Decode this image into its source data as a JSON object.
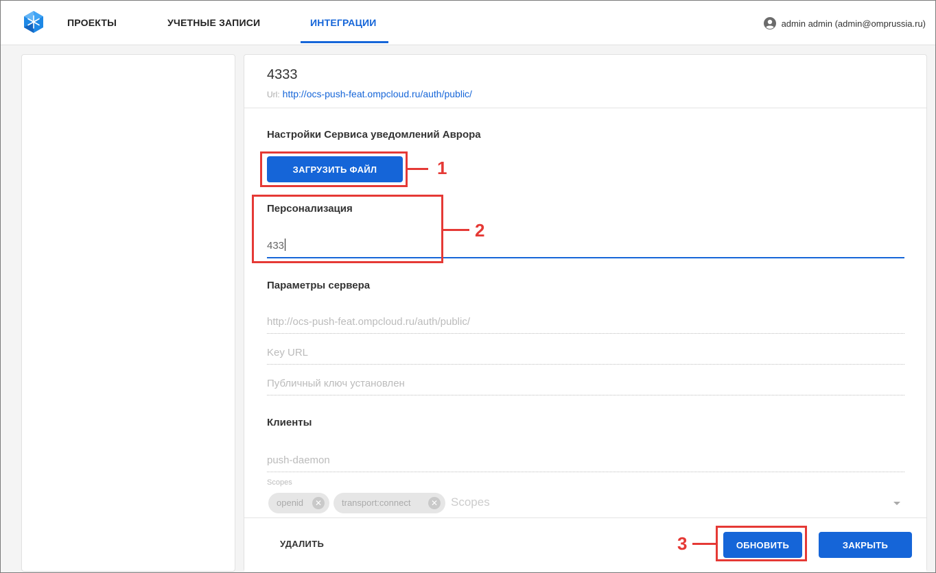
{
  "nav": {
    "projects": "ПРОЕКТЫ",
    "accounts": "УЧЕТНЫЕ ЗАПИСИ",
    "integrations": "ИНТЕГРАЦИИ",
    "user": "admin admin (admin@omprussia.ru)"
  },
  "integration": {
    "title": "4333",
    "url_prefix": "Url:",
    "url": "http://ocs-push-feat.ompcloud.ru/auth/public/"
  },
  "settings": {
    "title": "Настройки Сервиса уведомлений Аврора",
    "upload_button": "ЗАГРУЗИТЬ ФАЙЛ"
  },
  "personalization": {
    "title": "Персонализация",
    "value": "433"
  },
  "server": {
    "title": "Параметры сервера",
    "url_field": "http://ocs-push-feat.ompcloud.ru/auth/public/",
    "key_url_placeholder": "Key URL",
    "public_key_field": "Публичный ключ установлен"
  },
  "clients": {
    "title": "Клиенты",
    "client_name": "push-daemon",
    "scopes_label": "Scopes",
    "scopes": [
      "openid",
      "transport:connect"
    ],
    "scopes_placeholder": "Scopes"
  },
  "footer": {
    "delete": "УДАЛИТЬ",
    "update": "ОБНОВИТЬ",
    "close": "ЗАКРЫТЬ"
  },
  "annotations": [
    "1",
    "2",
    "3"
  ],
  "colors": {
    "accent": "#1565d8",
    "annotation": "#e53935"
  }
}
